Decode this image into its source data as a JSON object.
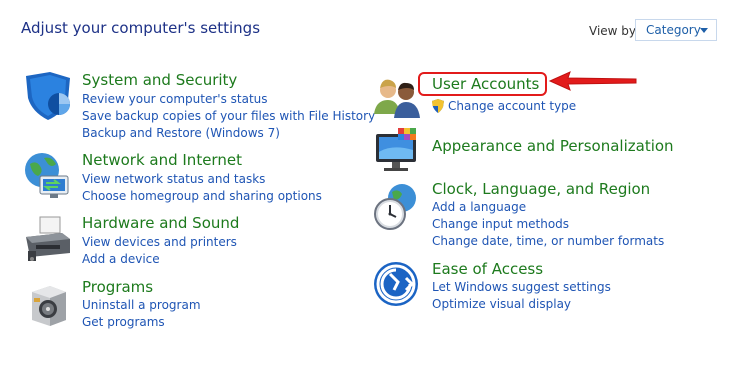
{
  "header": {
    "title": "Adjust your computer's settings",
    "view_by_label": "View by:",
    "view_by_value": "Category"
  },
  "categories": [
    {
      "title": "System and Security",
      "icon": "shield-icon",
      "links": [
        "Review your computer's status",
        "Save backup copies of your files with File History",
        "Backup and Restore (Windows 7)"
      ]
    },
    {
      "title": "Network and Internet",
      "icon": "network-globe-icon",
      "links": [
        "View network status and tasks",
        "Choose homegroup and sharing options"
      ]
    },
    {
      "title": "Hardware and Sound",
      "icon": "printer-icon",
      "links": [
        "View devices and printers",
        "Add a device"
      ]
    },
    {
      "title": "Programs",
      "icon": "programs-box-icon",
      "links": [
        "Uninstall a program",
        "Get programs"
      ]
    },
    {
      "title": "User Accounts",
      "icon": "users-icon",
      "links": [
        "Change account type"
      ],
      "link_icon": "uac-shield-icon"
    },
    {
      "title": "Appearance and Personalization",
      "icon": "monitor-palette-icon",
      "links": []
    },
    {
      "title": "Clock, Language, and Region",
      "icon": "clock-globe-icon",
      "links": [
        "Add a language",
        "Change input methods",
        "Change date, time, or number formats"
      ]
    },
    {
      "title": "Ease of Access",
      "icon": "ease-of-access-icon",
      "links": [
        "Let Windows suggest settings",
        "Optimize visual display"
      ]
    }
  ],
  "annotation": {
    "highlight_color": "#e21b1b",
    "arrow_color": "#e21b1b"
  }
}
